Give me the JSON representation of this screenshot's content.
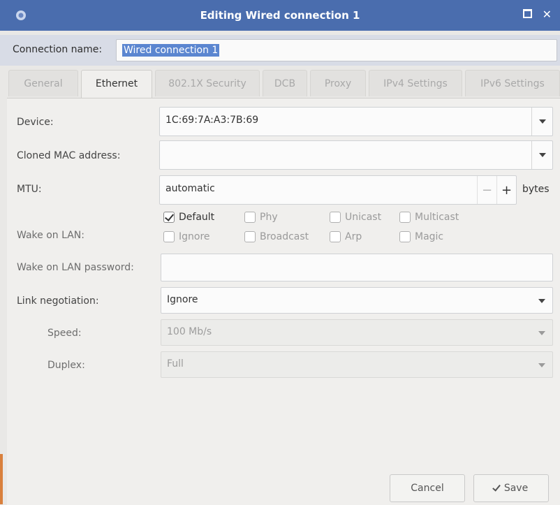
{
  "window": {
    "title": "Editing Wired connection 1"
  },
  "connection_name": {
    "label": "Connection name:",
    "value": "Wired connection 1"
  },
  "tabs": [
    {
      "label": "General",
      "active": false
    },
    {
      "label": "Ethernet",
      "active": true
    },
    {
      "label": "802.1X Security",
      "active": false
    },
    {
      "label": "DCB",
      "active": false
    },
    {
      "label": "Proxy",
      "active": false
    },
    {
      "label": "IPv4 Settings",
      "active": false
    },
    {
      "label": "IPv6 Settings",
      "active": false
    }
  ],
  "ethernet": {
    "device": {
      "label": "Device:",
      "value": "1C:69:7A:A3:7B:69"
    },
    "cloned_mac": {
      "label": "Cloned MAC address:",
      "value": ""
    },
    "mtu": {
      "label": "MTU:",
      "value": "automatic",
      "minus": "−",
      "plus": "+",
      "unit": "bytes"
    },
    "wake_on_lan": {
      "label": "Wake on LAN:",
      "options": [
        {
          "label": "Default",
          "checked": true
        },
        {
          "label": "Phy",
          "checked": false
        },
        {
          "label": "Unicast",
          "checked": false
        },
        {
          "label": "Multicast",
          "checked": false
        },
        {
          "label": "Ignore",
          "checked": false
        },
        {
          "label": "Broadcast",
          "checked": false
        },
        {
          "label": "Arp",
          "checked": false
        },
        {
          "label": "Magic",
          "checked": false
        }
      ]
    },
    "wol_password": {
      "label": "Wake on LAN password:",
      "value": ""
    },
    "link_negotiation": {
      "label": "Link negotiation:",
      "value": "Ignore"
    },
    "speed": {
      "label": "Speed:",
      "value": "100 Mb/s"
    },
    "duplex": {
      "label": "Duplex:",
      "value": "Full"
    }
  },
  "buttons": {
    "cancel": "Cancel",
    "save": "Save"
  },
  "colors": {
    "titlebar": "#4a6dae",
    "selection": "#5b86d0",
    "background": "#e9e8e6"
  }
}
